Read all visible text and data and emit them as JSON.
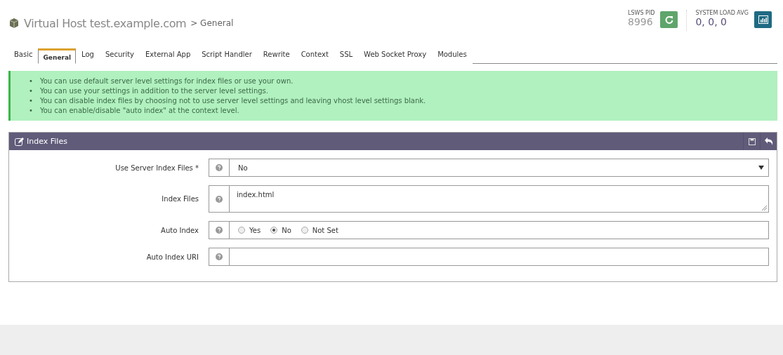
{
  "header": {
    "title": "Virtual Host test.example.com",
    "crumb": "> General",
    "pid_label": "LSWS PID",
    "pid": "8996",
    "load_label": "SYSTEM LOAD AVG",
    "load": "0, 0, 0"
  },
  "tabs": [
    {
      "label": "Basic",
      "selected": false
    },
    {
      "label": "General",
      "selected": true
    },
    {
      "label": "Log",
      "selected": false
    },
    {
      "label": "Security",
      "selected": false
    },
    {
      "label": "External App",
      "selected": false
    },
    {
      "label": "Script Handler",
      "selected": false
    },
    {
      "label": "Rewrite",
      "selected": false
    },
    {
      "label": "Context",
      "selected": false
    },
    {
      "label": "SSL",
      "selected": false
    },
    {
      "label": "Web Socket Proxy",
      "selected": false
    },
    {
      "label": "Modules",
      "selected": false
    }
  ],
  "notes": [
    {
      "bullet": "•",
      "text": "You can use default server level settings for index files or use your own."
    },
    {
      "bullet": "•",
      "text": "You can use your settings in addition to the server level settings."
    },
    {
      "bullet": "•",
      "text": "You can disable index files by choosing not to use server level settings and leaving vhost level settings blank."
    },
    {
      "bullet": "•",
      "text": "You can enable/disable \"auto index\" at the context level."
    }
  ],
  "panel": {
    "title": "Index Files",
    "fields": [
      {
        "kind": "select",
        "label": "Use Server Index Files *",
        "value": "No"
      },
      {
        "kind": "textarea",
        "label": "Index Files",
        "value": "index.html"
      },
      {
        "kind": "radio",
        "label": "Auto Index",
        "options": [
          {
            "label": "Yes",
            "selected": false
          },
          {
            "label": "No",
            "selected": true
          },
          {
            "label": "Not Set",
            "selected": false
          }
        ]
      },
      {
        "kind": "text",
        "label": "Auto Index URI"
      }
    ]
  }
}
